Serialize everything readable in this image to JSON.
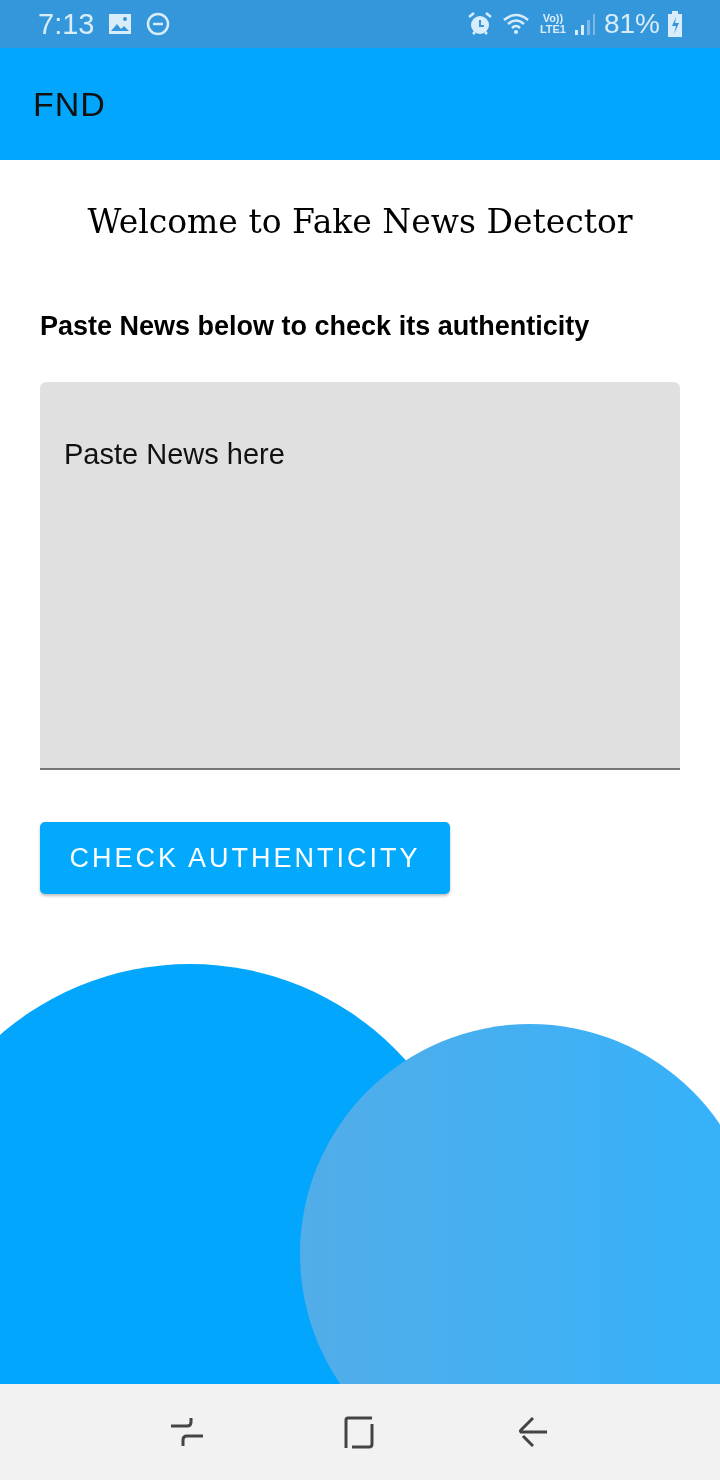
{
  "status_bar": {
    "time": "7:13",
    "network_top": "Vo))",
    "network_bottom": "LTE1",
    "battery": "81%"
  },
  "app_bar": {
    "title": "FND"
  },
  "heading": "Welcome to Fake News Detector",
  "instruction": "Paste News below to check its authenticity",
  "news_field": {
    "placeholder": "Paste News here"
  },
  "check_button": {
    "label": "CHECK AUTHENTICITY"
  }
}
